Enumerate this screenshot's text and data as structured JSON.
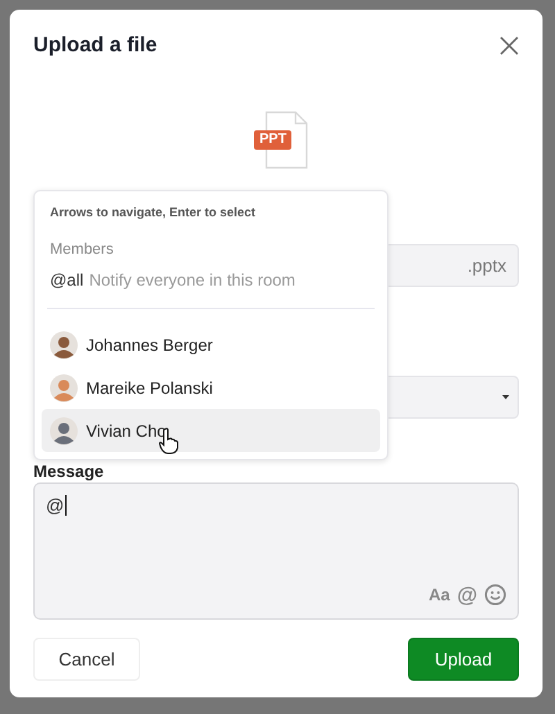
{
  "dialog": {
    "title": "Upload a file",
    "file_badge": "PPT",
    "name_field": {
      "suffix": ".pptx"
    },
    "message": {
      "label": "Message",
      "value": "@",
      "tools": [
        "Aa",
        "@"
      ]
    },
    "buttons": [
      {
        "label": "Cancel",
        "kind": "secondary"
      },
      {
        "label": "Upload",
        "kind": "primary"
      }
    ]
  },
  "mention_popup": {
    "hint": "Arrows to navigate, Enter to select",
    "section": "Members",
    "all": {
      "handle": "@all",
      "description": "Notify everyone in this room"
    },
    "members": [
      {
        "name": "Johannes Berger",
        "selected": false
      },
      {
        "name": "Mareike Polanski",
        "selected": false
      },
      {
        "name": "Vivian Cho",
        "selected": true
      }
    ]
  }
}
